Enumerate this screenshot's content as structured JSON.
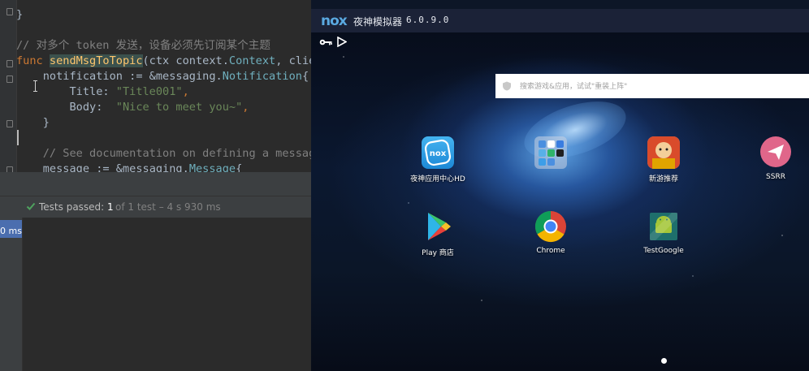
{
  "editor": {
    "lines": [
      {
        "tokens": [
          {
            "t": "}",
            "c": "pl"
          }
        ]
      },
      {
        "tokens": []
      },
      {
        "tokens": [
          {
            "t": "// 对多个 token 发送，设备必须先订阅某个主题",
            "c": "cmt"
          }
        ]
      },
      {
        "tokens": [
          {
            "t": "func ",
            "c": "kw"
          },
          {
            "t": "sendMsgToTopic",
            "c": "fn-hl"
          },
          {
            "t": "(ctx ",
            "c": "pl"
          },
          {
            "t": "context",
            "c": "pl"
          },
          {
            "t": ".",
            "c": "pl"
          },
          {
            "t": "Context",
            "c": "ty"
          },
          {
            "t": ", clie",
            "c": "pl"
          }
        ]
      },
      {
        "tokens": [
          {
            "t": "    notification := &",
            "c": "pl"
          },
          {
            "t": "messaging",
            "c": "pl"
          },
          {
            "t": ".",
            "c": "pl"
          },
          {
            "t": "Notification",
            "c": "ty"
          },
          {
            "t": "{",
            "c": "pl"
          }
        ]
      },
      {
        "tokens": [
          {
            "t": "        Title: ",
            "c": "pl"
          },
          {
            "t": "\"Title001\"",
            "c": "str"
          },
          {
            "t": ",",
            "c": "kw"
          }
        ]
      },
      {
        "tokens": [
          {
            "t": "        Body:  ",
            "c": "pl"
          },
          {
            "t": "\"Nice to meet you~\"",
            "c": "str"
          },
          {
            "t": ",",
            "c": "kw"
          }
        ]
      },
      {
        "tokens": [
          {
            "t": "    }",
            "c": "pl"
          }
        ]
      },
      {
        "tokens": []
      },
      {
        "tokens": [
          {
            "t": "    // See documentation on defining a messag",
            "c": "cmt"
          }
        ]
      },
      {
        "tokens": [
          {
            "t": "    message := &",
            "c": "pl"
          },
          {
            "t": "messaging",
            "c": "pl"
          },
          {
            "t": ".",
            "c": "pl"
          },
          {
            "t": "Message",
            "c": "ty"
          },
          {
            "t": "{",
            "c": "pl"
          }
        ]
      }
    ]
  },
  "test_status": {
    "label": "Tests passed: ",
    "count": "1",
    "detail": "of 1 test – 4 s 930 ms",
    "duration_cell": "0 ms"
  },
  "emulator": {
    "logo": "nox",
    "title": "夜神模拟器",
    "version": "6.0.9.0",
    "search_placeholder": "搜索游戏&应用，试试\"重装上阵\"",
    "apps": [
      {
        "label": "夜神应用中心HD",
        "icon": "nox-app-center-icon"
      },
      {
        "label": "",
        "icon": "app-folder-icon"
      },
      {
        "label": "新游推荐",
        "icon": "new-game-icon"
      },
      {
        "label": "SSRR",
        "icon": "ssrr-icon"
      },
      {
        "label": "Play 商店",
        "icon": "play-store-icon"
      },
      {
        "label": "Chrome",
        "icon": "chrome-icon"
      },
      {
        "label": "TestGoogle",
        "icon": "testgoogle-icon"
      }
    ]
  },
  "colors": {
    "ide_background": "#2b2b2b",
    "keyword": "#cc7832",
    "string": "#6a8759",
    "comment": "#808080",
    "function_highlight": "#ffc66d",
    "pass_green": "#4ea25e",
    "emulator_titlebar": "#1b2237"
  }
}
